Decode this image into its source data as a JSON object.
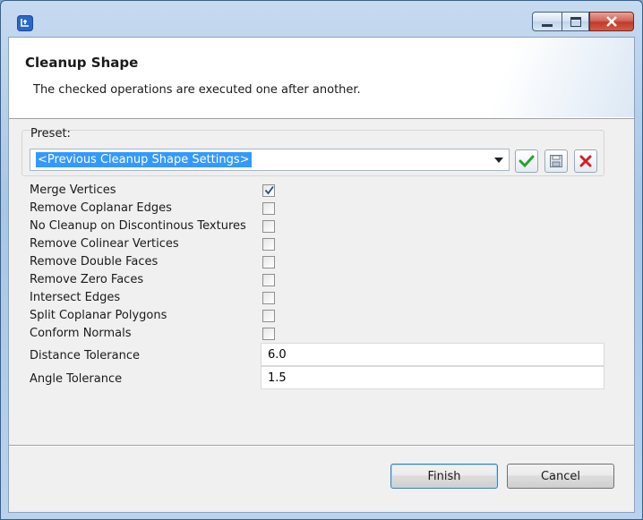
{
  "window": {
    "controls": {
      "minimize": "minimize",
      "maximize": "maximize",
      "close": "close"
    }
  },
  "banner": {
    "title": "Cleanup Shape",
    "description": "The checked operations are executed one after another."
  },
  "preset": {
    "label": "Preset:",
    "selected": "<Previous Cleanup Shape Settings>",
    "tools": [
      "apply-check-icon",
      "save-icon",
      "delete-x-icon"
    ]
  },
  "options": [
    {
      "label": "Merge Vertices",
      "checked": true
    },
    {
      "label": "Remove Coplanar Edges",
      "checked": false
    },
    {
      "label": "No Cleanup on Discontinous Textures",
      "checked": false
    },
    {
      "label": "Remove Colinear Vertices",
      "checked": false
    },
    {
      "label": "Remove Double Faces",
      "checked": false
    },
    {
      "label": "Remove Zero Faces",
      "checked": false
    },
    {
      "label": "Intersect Edges",
      "checked": false
    },
    {
      "label": "Split Coplanar Polygons",
      "checked": false
    },
    {
      "label": "Conform Normals",
      "checked": false
    }
  ],
  "fields": {
    "distance": {
      "label": "Distance Tolerance",
      "value": "6.0"
    },
    "angle": {
      "label": "Angle Tolerance",
      "value": "1.5"
    }
  },
  "buttons": {
    "finish": "Finish",
    "cancel": "Cancel"
  },
  "colors": {
    "selection": "#3399ff",
    "check_green": "#2f9e2f",
    "delete_red": "#d32020",
    "close_red": "#c8442f"
  }
}
